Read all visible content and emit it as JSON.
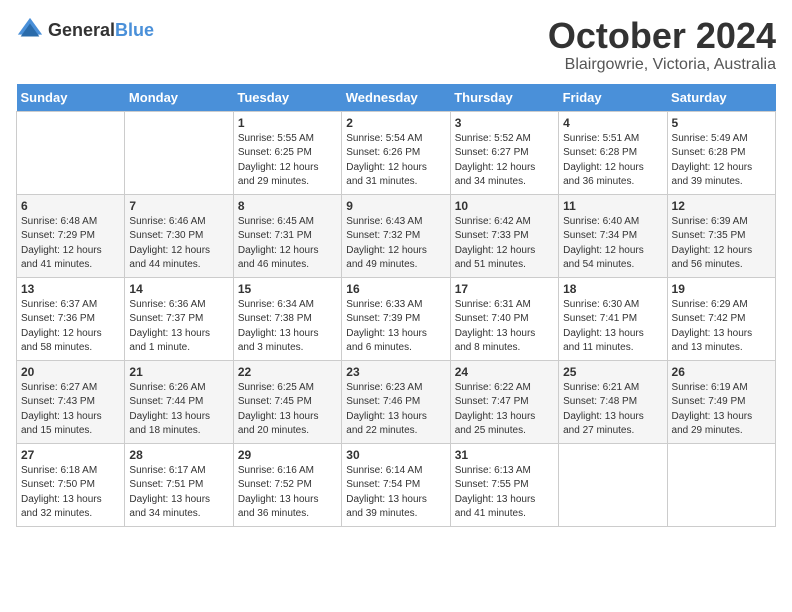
{
  "logo": {
    "general": "General",
    "blue": "Blue"
  },
  "title": "October 2024",
  "subtitle": "Blairgowrie, Victoria, Australia",
  "days_of_week": [
    "Sunday",
    "Monday",
    "Tuesday",
    "Wednesday",
    "Thursday",
    "Friday",
    "Saturday"
  ],
  "weeks": [
    [
      {
        "day": "",
        "info": ""
      },
      {
        "day": "",
        "info": ""
      },
      {
        "day": "1",
        "info": "Sunrise: 5:55 AM\nSunset: 6:25 PM\nDaylight: 12 hours and 29 minutes."
      },
      {
        "day": "2",
        "info": "Sunrise: 5:54 AM\nSunset: 6:26 PM\nDaylight: 12 hours and 31 minutes."
      },
      {
        "day": "3",
        "info": "Sunrise: 5:52 AM\nSunset: 6:27 PM\nDaylight: 12 hours and 34 minutes."
      },
      {
        "day": "4",
        "info": "Sunrise: 5:51 AM\nSunset: 6:28 PM\nDaylight: 12 hours and 36 minutes."
      },
      {
        "day": "5",
        "info": "Sunrise: 5:49 AM\nSunset: 6:28 PM\nDaylight: 12 hours and 39 minutes."
      }
    ],
    [
      {
        "day": "6",
        "info": "Sunrise: 6:48 AM\nSunset: 7:29 PM\nDaylight: 12 hours and 41 minutes."
      },
      {
        "day": "7",
        "info": "Sunrise: 6:46 AM\nSunset: 7:30 PM\nDaylight: 12 hours and 44 minutes."
      },
      {
        "day": "8",
        "info": "Sunrise: 6:45 AM\nSunset: 7:31 PM\nDaylight: 12 hours and 46 minutes."
      },
      {
        "day": "9",
        "info": "Sunrise: 6:43 AM\nSunset: 7:32 PM\nDaylight: 12 hours and 49 minutes."
      },
      {
        "day": "10",
        "info": "Sunrise: 6:42 AM\nSunset: 7:33 PM\nDaylight: 12 hours and 51 minutes."
      },
      {
        "day": "11",
        "info": "Sunrise: 6:40 AM\nSunset: 7:34 PM\nDaylight: 12 hours and 54 minutes."
      },
      {
        "day": "12",
        "info": "Sunrise: 6:39 AM\nSunset: 7:35 PM\nDaylight: 12 hours and 56 minutes."
      }
    ],
    [
      {
        "day": "13",
        "info": "Sunrise: 6:37 AM\nSunset: 7:36 PM\nDaylight: 12 hours and 58 minutes."
      },
      {
        "day": "14",
        "info": "Sunrise: 6:36 AM\nSunset: 7:37 PM\nDaylight: 13 hours and 1 minute."
      },
      {
        "day": "15",
        "info": "Sunrise: 6:34 AM\nSunset: 7:38 PM\nDaylight: 13 hours and 3 minutes."
      },
      {
        "day": "16",
        "info": "Sunrise: 6:33 AM\nSunset: 7:39 PM\nDaylight: 13 hours and 6 minutes."
      },
      {
        "day": "17",
        "info": "Sunrise: 6:31 AM\nSunset: 7:40 PM\nDaylight: 13 hours and 8 minutes."
      },
      {
        "day": "18",
        "info": "Sunrise: 6:30 AM\nSunset: 7:41 PM\nDaylight: 13 hours and 11 minutes."
      },
      {
        "day": "19",
        "info": "Sunrise: 6:29 AM\nSunset: 7:42 PM\nDaylight: 13 hours and 13 minutes."
      }
    ],
    [
      {
        "day": "20",
        "info": "Sunrise: 6:27 AM\nSunset: 7:43 PM\nDaylight: 13 hours and 15 minutes."
      },
      {
        "day": "21",
        "info": "Sunrise: 6:26 AM\nSunset: 7:44 PM\nDaylight: 13 hours and 18 minutes."
      },
      {
        "day": "22",
        "info": "Sunrise: 6:25 AM\nSunset: 7:45 PM\nDaylight: 13 hours and 20 minutes."
      },
      {
        "day": "23",
        "info": "Sunrise: 6:23 AM\nSunset: 7:46 PM\nDaylight: 13 hours and 22 minutes."
      },
      {
        "day": "24",
        "info": "Sunrise: 6:22 AM\nSunset: 7:47 PM\nDaylight: 13 hours and 25 minutes."
      },
      {
        "day": "25",
        "info": "Sunrise: 6:21 AM\nSunset: 7:48 PM\nDaylight: 13 hours and 27 minutes."
      },
      {
        "day": "26",
        "info": "Sunrise: 6:19 AM\nSunset: 7:49 PM\nDaylight: 13 hours and 29 minutes."
      }
    ],
    [
      {
        "day": "27",
        "info": "Sunrise: 6:18 AM\nSunset: 7:50 PM\nDaylight: 13 hours and 32 minutes."
      },
      {
        "day": "28",
        "info": "Sunrise: 6:17 AM\nSunset: 7:51 PM\nDaylight: 13 hours and 34 minutes."
      },
      {
        "day": "29",
        "info": "Sunrise: 6:16 AM\nSunset: 7:52 PM\nDaylight: 13 hours and 36 minutes."
      },
      {
        "day": "30",
        "info": "Sunrise: 6:14 AM\nSunset: 7:54 PM\nDaylight: 13 hours and 39 minutes."
      },
      {
        "day": "31",
        "info": "Sunrise: 6:13 AM\nSunset: 7:55 PM\nDaylight: 13 hours and 41 minutes."
      },
      {
        "day": "",
        "info": ""
      },
      {
        "day": "",
        "info": ""
      }
    ]
  ]
}
